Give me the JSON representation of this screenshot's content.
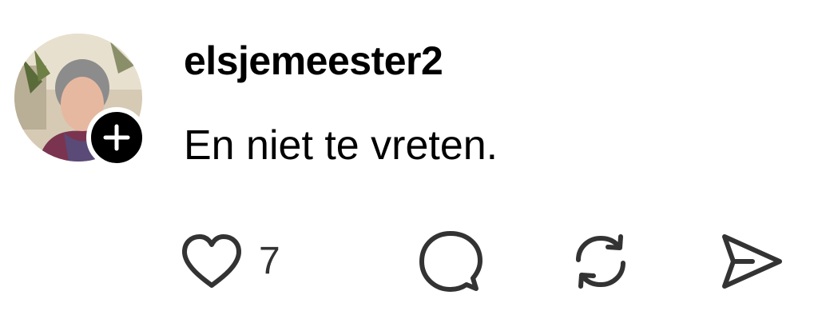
{
  "post": {
    "username": "elsjemeester2",
    "text": "En niet te vreten."
  },
  "actions": {
    "like_count": "7"
  },
  "icons": {
    "follow": "plus-icon",
    "like": "heart-icon",
    "comment": "comment-bubble-icon",
    "repost": "repost-icon",
    "share": "send-icon"
  },
  "colors": {
    "text": "#000000",
    "icon": "#333333",
    "badge": "#000000"
  }
}
